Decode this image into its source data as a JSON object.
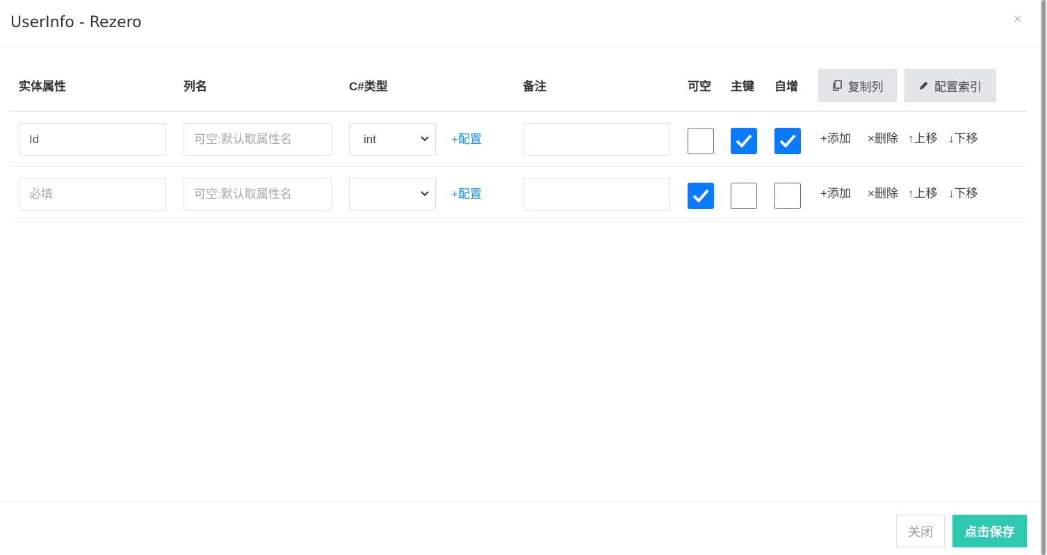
{
  "modal": {
    "title": "UserInfo - Rezero",
    "close_glyph": "×"
  },
  "table": {
    "headers": [
      "实体属性",
      "列名",
      "C#类型",
      "备注",
      "可空",
      "主键",
      "自增"
    ],
    "copy_columns_label": "复制列",
    "config_index_label": "配置索引",
    "rows": [
      {
        "property_value": "Id",
        "property_placeholder": "必填",
        "column_value": "",
        "column_placeholder": "可空:默认取属性名",
        "type_value": "int",
        "config_label": "+配置",
        "remark_value": "",
        "nullable": false,
        "primary_key": true,
        "auto_increment": true,
        "add_label": "+添加",
        "delete_label": "×删除",
        "up_label": "↑上移",
        "down_label": "↓下移"
      },
      {
        "property_value": "",
        "property_placeholder": "必填",
        "column_value": "",
        "column_placeholder": "可空:默认取属性名",
        "type_value": "",
        "config_label": "+配置",
        "remark_value": "",
        "nullable": true,
        "primary_key": false,
        "auto_increment": false,
        "add_label": "+添加",
        "delete_label": "×删除",
        "up_label": "↑上移",
        "down_label": "↓下移"
      }
    ]
  },
  "footer": {
    "close_label": "关闭",
    "save_label": "点击保存"
  },
  "colors": {
    "checkbox_checked": "#0a7bff",
    "link": "#1e90e6",
    "save_button": "#2ec9b1"
  },
  "icons": {
    "copy": "copy-icon",
    "edit": "pencil-icon",
    "caret": "chevron-down-icon",
    "check": "check-icon"
  }
}
